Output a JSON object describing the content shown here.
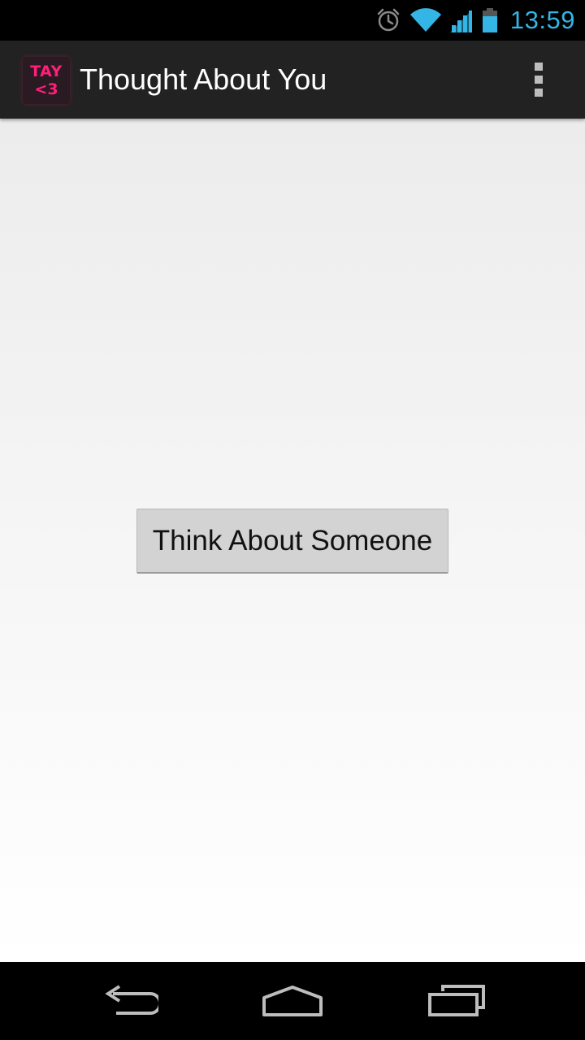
{
  "status_bar": {
    "time": "13:59",
    "icons": [
      "alarm-icon",
      "wifi-icon",
      "signal-icon",
      "battery-icon"
    ],
    "accent_color": "#33b5e5"
  },
  "action_bar": {
    "app_icon": {
      "line1": "TAY",
      "line2": "<3",
      "color": "#ff1f7a"
    },
    "title": "Thought About You",
    "overflow_icon": "overflow-menu-icon"
  },
  "main": {
    "button_label": "Think About Someone"
  },
  "nav_bar": {
    "icons": [
      "back-icon",
      "home-icon",
      "recents-icon"
    ]
  }
}
